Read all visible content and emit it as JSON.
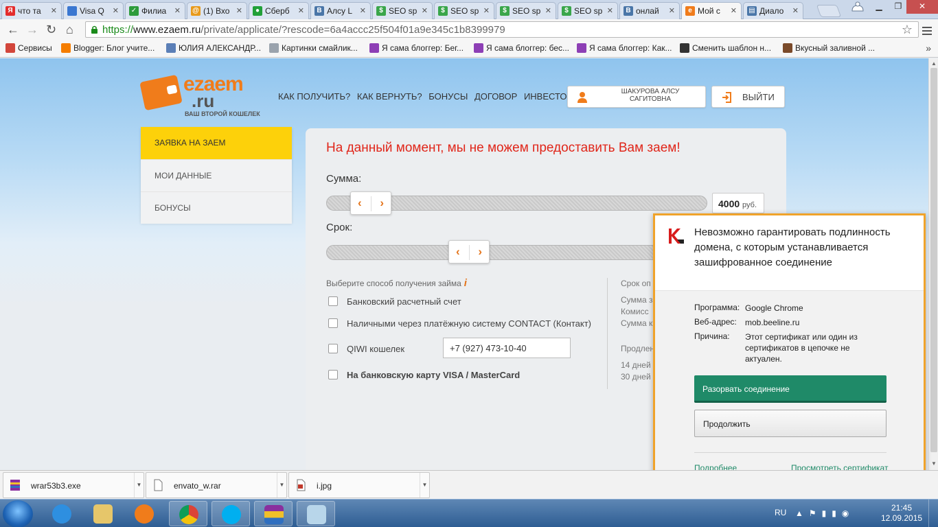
{
  "browser": {
    "tabs": [
      {
        "label": "что та",
        "icon": "yandex-icon",
        "color": "#e42d2d",
        "glyph": "Я"
      },
      {
        "label": "Visa Q",
        "icon": "loading-icon",
        "color": "#3a77d1",
        "glyph": ""
      },
      {
        "label": "Филиа",
        "icon": "document-icon",
        "color": "#2d9b3c",
        "glyph": "✓"
      },
      {
        "label": "(1) Вхо",
        "icon": "mail-icon",
        "color": "#e89a1b",
        "glyph": "@"
      },
      {
        "label": "Сберб",
        "icon": "sberbank-icon",
        "color": "#21a038",
        "glyph": "●"
      },
      {
        "label": "Алсу L",
        "icon": "vk-icon",
        "color": "#4a76a8",
        "glyph": "В"
      },
      {
        "label": "SEO sp",
        "icon": "seo-icon",
        "color": "#3aa64b",
        "glyph": "$"
      },
      {
        "label": "SEO sp",
        "icon": "seo-icon",
        "color": "#3aa64b",
        "glyph": "$"
      },
      {
        "label": "SEO sp",
        "icon": "seo-icon",
        "color": "#3aa64b",
        "glyph": "$"
      },
      {
        "label": "SEO sp",
        "icon": "seo-icon",
        "color": "#3aa64b",
        "glyph": "$"
      },
      {
        "label": "онлай",
        "icon": "vk-icon",
        "color": "#4a76a8",
        "glyph": "В"
      },
      {
        "label": "Мой с",
        "icon": "ezaem-icon",
        "color": "#f07c1b",
        "glyph": "e",
        "active": true
      },
      {
        "label": "Диало",
        "icon": "chat-icon",
        "color": "#4a76a8",
        "glyph": "▤"
      }
    ],
    "url_scheme": "https://",
    "url_host": "www.ezaem.ru",
    "url_rest": "/private/applicate/?rescode=6a4accc25f504f01a9e345c1b8399979",
    "bookmarks": [
      {
        "label": "Сервисы",
        "icon": "apps-icon",
        "color": "#d2463b"
      },
      {
        "label": "Blogger: Блог учите...",
        "icon": "blogger-icon",
        "color": "#f57d00"
      },
      {
        "label": "ЮЛИЯ АЛЕКСАНДР...",
        "icon": "bookmark-icon",
        "color": "#5b7fb7"
      },
      {
        "label": "Картинки смайлик...",
        "icon": "page-icon",
        "color": "#9aa3ad"
      },
      {
        "label": "Я сама блоггер: Бег...",
        "icon": "sb-icon",
        "color": "#8d3fb5"
      },
      {
        "label": "Я сама блоггер: бес...",
        "icon": "sb-icon",
        "color": "#8d3fb5"
      },
      {
        "label": "Я сама блоггер: Как...",
        "icon": "sb-icon",
        "color": "#8d3fb5"
      },
      {
        "label": "Сменить шаблон н...",
        "icon": "avatar-icon",
        "color": "#333333"
      },
      {
        "label": "Вкусный заливной ...",
        "icon": "food-icon",
        "color": "#7a4a2a"
      }
    ]
  },
  "site": {
    "logo_brand": "ezaem",
    "logo_domain": ".ru",
    "logo_tagline": "ВАШ ВТОРОЙ КОШЕЛЕК",
    "nav": [
      "КАК ПОЛУЧИТЬ?",
      "КАК ВЕРНУТЬ?",
      "БОНУСЫ",
      "ДОГОВОР",
      "ИНВЕСТОРАМ"
    ],
    "user_name": "ШАКУРОВА АЛСУ САГИТОВНА",
    "logout_label": "ВЫЙТИ",
    "sidebar": [
      {
        "label": "ЗАЯВКА НА ЗАЕМ",
        "active": true
      },
      {
        "label": "МОИ ДАННЫЕ",
        "active": false
      },
      {
        "label": "БОНУСЫ",
        "active": false
      }
    ],
    "headline": "На данный момент, мы не можем предоставить Вам заем!",
    "amount_label": "Сумма:",
    "amount_value": "4000",
    "amount_unit": "руб.",
    "term_label": "Срок:",
    "method_hint": "Выберите способ получения займа",
    "options": [
      {
        "label": "Банковский расчетный счет"
      },
      {
        "label": "Наличными через платёжную систему CONTACT (Контакт)"
      },
      {
        "label": "QIWI кошелек"
      },
      {
        "label": "На банковскую карту VISA / MasterCard"
      }
    ],
    "phone_value": "+7 (927) 473-10-40",
    "right_col": [
      "Срок оп",
      "Сумма з",
      "Комисс",
      "Сумма к",
      "Продлен",
      "14 дней",
      "30 дней"
    ]
  },
  "popup": {
    "title": "Невозможно гарантировать подлинность домена, с которым устанавливается зашифрованное соединение",
    "program_key": "Программа:",
    "program_val": "Google Chrome",
    "address_key": "Веб-адрес:",
    "address_val": "mob.beeline.ru",
    "reason_key": "Причина:",
    "reason_val": "Этот сертификат или один из сертификатов в цепочке не актуален.",
    "break_button": "Разорвать соединение",
    "continue_button": "Продолжить",
    "more_link": "Подробнее",
    "cert_link": "Просмотреть сертификат"
  },
  "downloads": [
    {
      "name": "wrar53b3.exe",
      "icon": "winrar-icon"
    },
    {
      "name": "envato_w.rar",
      "icon": "file-icon"
    },
    {
      "name": "i.jpg",
      "icon": "image-file-icon"
    }
  ],
  "taskbar": {
    "lang": "RU",
    "time": "21:45",
    "date": "12.09.2015"
  },
  "colors": {
    "accent_orange": "#f07c1b",
    "sidebar_active": "#fdd10a",
    "error_red": "#e0261a",
    "kaspersky_green": "#1f8a68",
    "popup_border": "#f0a32a"
  }
}
